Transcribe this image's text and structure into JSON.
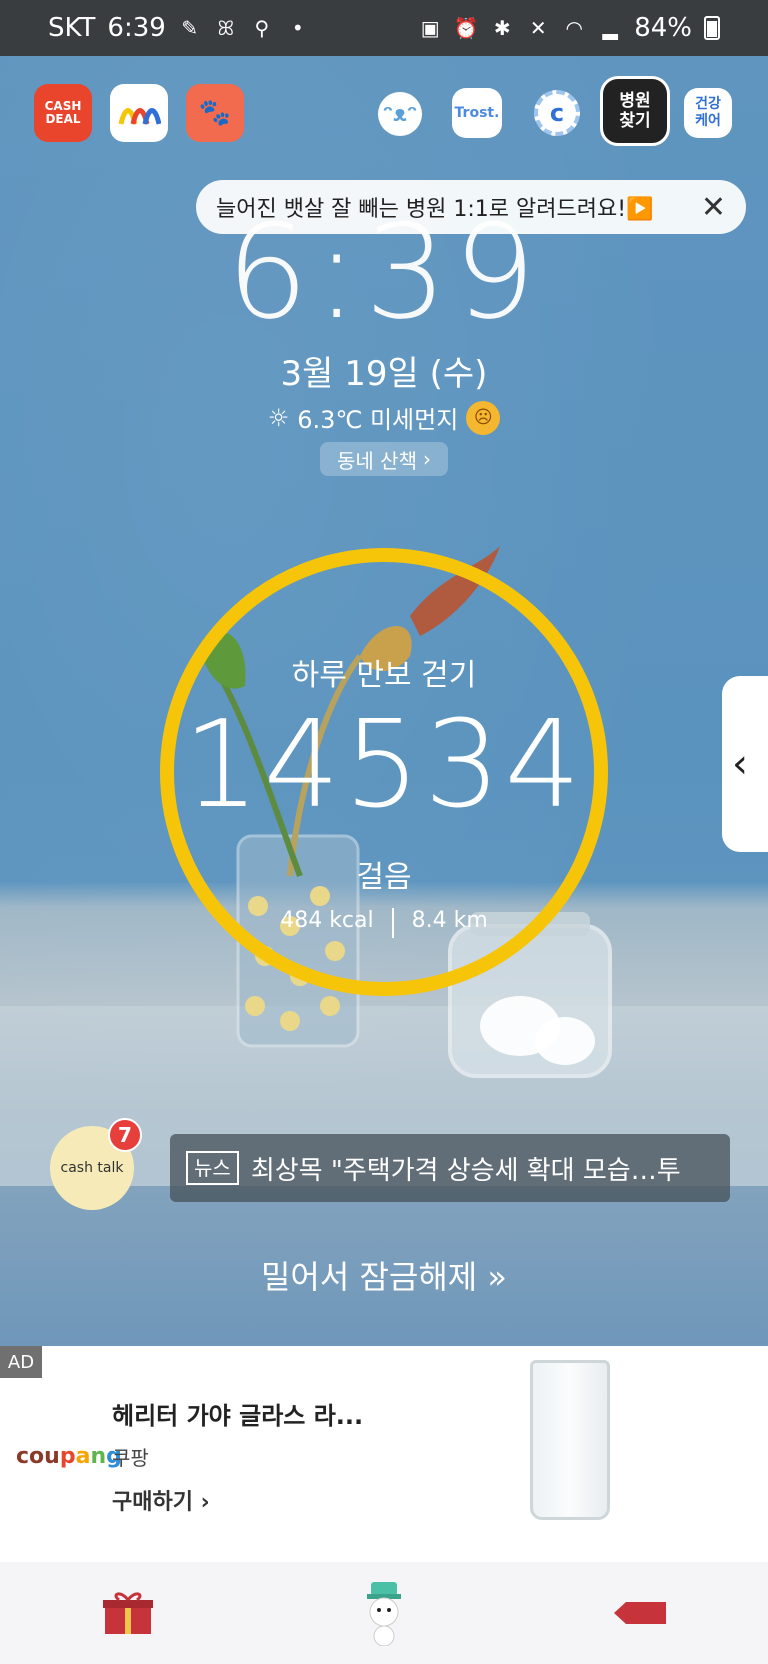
{
  "status_bar": {
    "carrier": "SKT",
    "time": "6:39",
    "battery": "84%"
  },
  "top_apps": {
    "cashdeal_label": "CASH\nDEAL",
    "trost_label": "Trost.",
    "hospital_label": "병원\n찾기",
    "healthcare_label": "건강\n케어"
  },
  "banner": {
    "text": "늘어진 뱃살 잘 빼는 병원 1:1로 알려드려요!▶️",
    "close": "✕"
  },
  "lock": {
    "clock": "6:39",
    "date": "3월 19일 (수)",
    "weather": "6.3℃ 미세먼지",
    "walk_chip": "동네 산책",
    "walk_title": "하루 만보 걷기",
    "steps": "14534",
    "steps_unit": "걸음",
    "kcal": "484 kcal",
    "distance": "8.4 km",
    "unlock_hint": "밀어서 잠금해제",
    "side_tab_arrow": "‹"
  },
  "cashtalk": {
    "label": "cash talk",
    "badge": "7"
  },
  "news": {
    "tag": "뉴스",
    "headline": "최상목 \"주택가격 상승세 확대 모습…투"
  },
  "ad": {
    "label": "AD",
    "brand": "coupang",
    "title": "헤리터 가야 글라스 라...",
    "seller": "쿠팡",
    "cta": "구매하기"
  },
  "colors": {
    "ring": "#f6c50a",
    "badge": "#e7403c",
    "cashdeal": "#e8452c",
    "cashtree": "#f26b4f"
  }
}
